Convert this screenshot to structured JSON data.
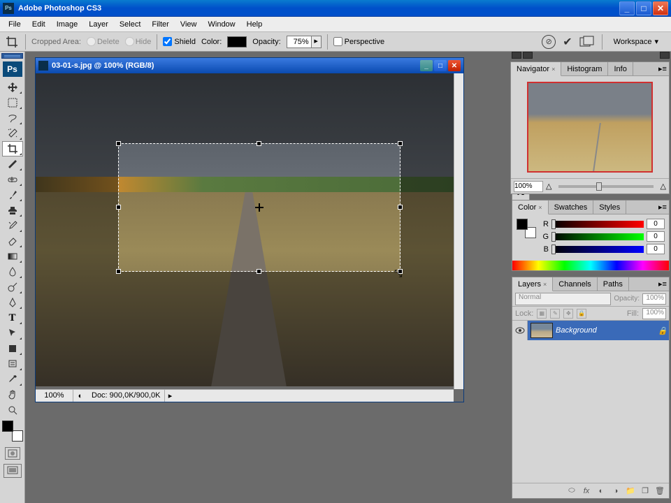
{
  "app": {
    "title": "Adobe Photoshop CS3"
  },
  "menu": {
    "items": [
      "File",
      "Edit",
      "Image",
      "Layer",
      "Select",
      "Filter",
      "View",
      "Window",
      "Help"
    ]
  },
  "options": {
    "cropped_area_label": "Cropped Area:",
    "delete_opt": "Delete",
    "hide_opt": "Hide",
    "shield_label": "Shield",
    "shield_checked": true,
    "color_label": "Color:",
    "opacity_label": "Opacity:",
    "opacity_value": "75%",
    "perspective_label": "Perspective",
    "perspective_checked": false,
    "workspace_label": "Workspace"
  },
  "document": {
    "title": "03-01-s.jpg @ 100% (RGB/8)",
    "zoom": "100%",
    "status": "Doc: 900,0K/900,0K"
  },
  "navigator": {
    "tabs": [
      "Navigator",
      "Histogram",
      "Info"
    ],
    "zoom": "100%"
  },
  "color": {
    "tabs": [
      "Color",
      "Swatches",
      "Styles"
    ],
    "r": "0",
    "g": "0",
    "b": "0",
    "r_label": "R",
    "g_label": "G",
    "b_label": "B"
  },
  "layers": {
    "tabs": [
      "Layers",
      "Channels",
      "Paths"
    ],
    "blend_mode": "Normal",
    "opacity_label": "Opacity:",
    "opacity_value": "100%",
    "lock_label": "Lock:",
    "fill_label": "Fill:",
    "fill_value": "100%",
    "layer_name": "Background"
  }
}
